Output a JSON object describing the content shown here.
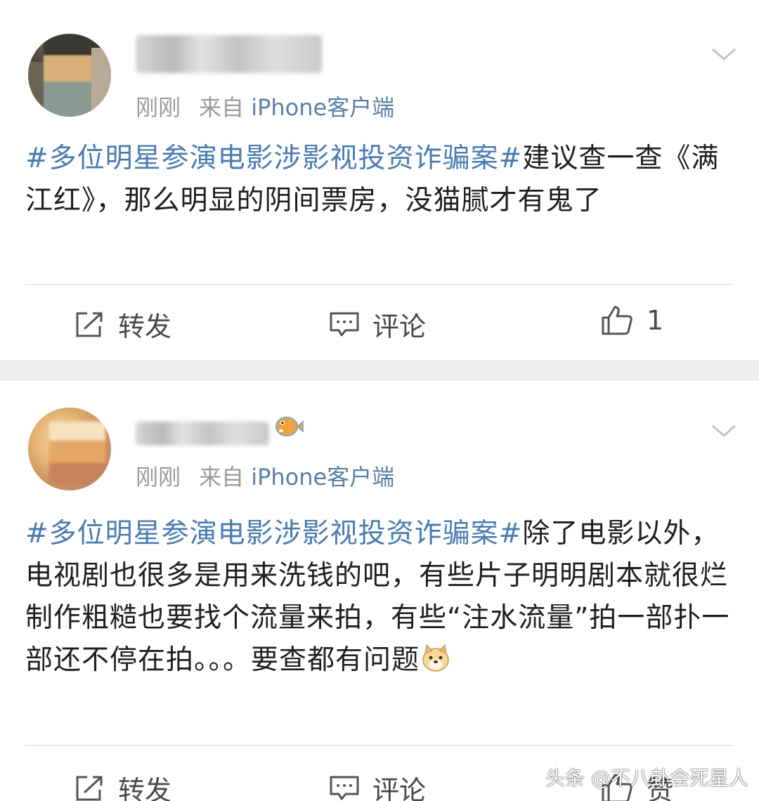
{
  "posts": [
    {
      "time": "刚刚",
      "source_prefix": "来自",
      "source_app": "iPhone客户端",
      "hashtag": "#多位明星参演电影涉影视投资诈骗案#",
      "text": "建议查一查《满江红》，那么明显的阴间票房，没猫腻才有鬼了",
      "actions": {
        "repost": "转发",
        "comment": "评论",
        "like_count": "1"
      }
    },
    {
      "time": "刚刚",
      "source_prefix": "来自",
      "source_app": "iPhone客户端",
      "hashtag": "#多位明星参演电影涉影视投资诈骗案#",
      "text": "除了电影以外，电视剧也很多是用来洗钱的吧，有些片子明明剧本就很烂制作粗糙也要找个流量来拍，有些“注水流量”拍一部扑一部还不停在拍。。。要查都有问题",
      "emoji": "doge-emoji",
      "actions": {
        "repost": "转发",
        "comment": "评论",
        "like": "赞"
      }
    }
  ],
  "watermark": "头条 @不八卦会死星人",
  "colors": {
    "hashtag": "#4a7bb0",
    "source": "#5b7fa6",
    "separator": "#efefef"
  }
}
